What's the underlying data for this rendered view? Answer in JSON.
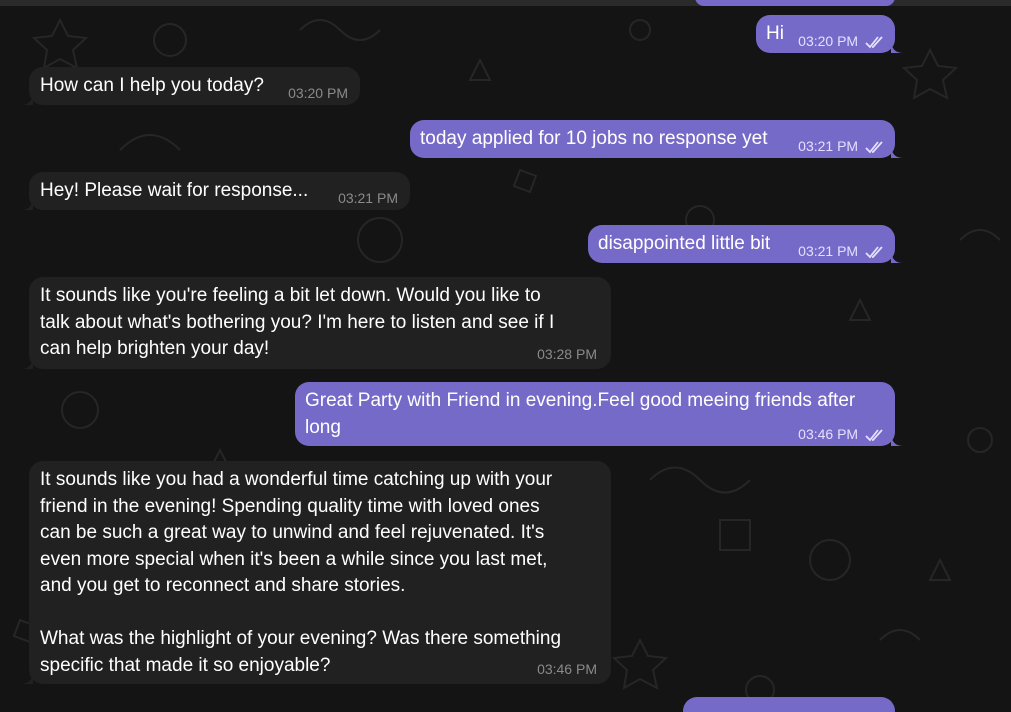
{
  "chat": {
    "messages": [
      {
        "id": "m1",
        "dir": "out",
        "text": "Hi",
        "time": "03:20 PM",
        "read": true
      },
      {
        "id": "m2",
        "dir": "in",
        "text": "How can I help you today?",
        "time": "03:20 PM"
      },
      {
        "id": "m3",
        "dir": "out",
        "text": "today applied for 10 jobs no response yet",
        "time": "03:21 PM",
        "read": true
      },
      {
        "id": "m4",
        "dir": "in",
        "text": "Hey! Please wait for response...",
        "time": "03:21 PM"
      },
      {
        "id": "m5",
        "dir": "out",
        "text": "disappointed little bit",
        "time": "03:21 PM",
        "read": true
      },
      {
        "id": "m6",
        "dir": "in",
        "text": "It sounds like you're feeling a bit let down. Would you like to\ntalk about what's bothering you? I'm here to listen and see if I\ncan help brighten your day!",
        "time": "03:28 PM"
      },
      {
        "id": "m7",
        "dir": "out",
        "text": "Great Party with Friend in evening.Feel good meeing friends after\nlong",
        "time": "03:46 PM",
        "read": true
      },
      {
        "id": "m8",
        "dir": "in",
        "text": "It sounds like you had a wonderful time catching up with your\nfriend in the evening! Spending quality time with loved ones\ncan be such a great way to unwind and feel rejuvenated. It's\neven more special when it's been a while since you last met,\nand you get to reconnect and share stories.\n\nWhat was the highlight of your evening? Was there something\nspecific that made it so enjoyable?",
        "time": "03:46 PM"
      }
    ]
  },
  "colors": {
    "background": "#141414",
    "incoming_bubble": "#212121",
    "outgoing_bubble": "#766ac8",
    "incoming_time": "#8a8a8a",
    "outgoing_time": "#e4e0ff"
  }
}
